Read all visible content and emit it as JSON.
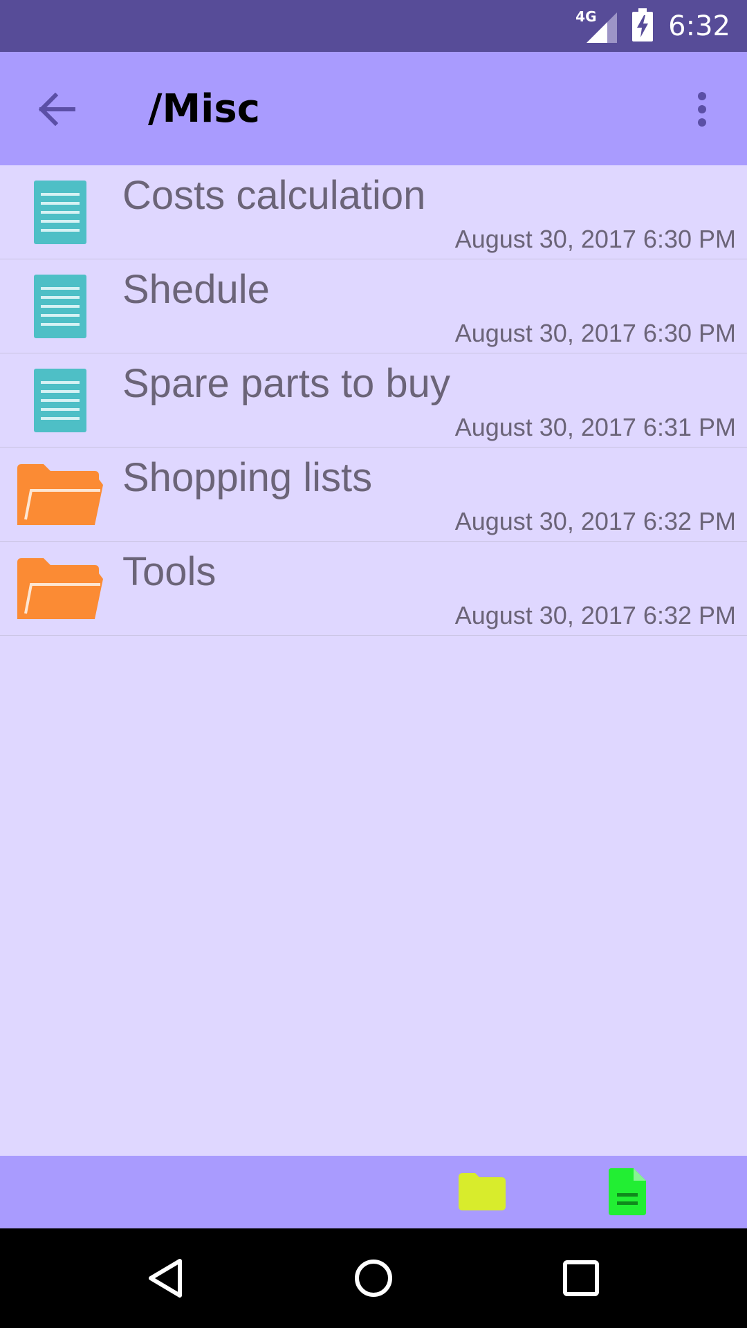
{
  "status_bar": {
    "network": "4G",
    "time": "6:32"
  },
  "app_bar": {
    "title": "/Misc",
    "back_icon": "arrow-left-icon",
    "menu_icon": "more-vertical-icon"
  },
  "items": [
    {
      "type": "note",
      "icon": "note-icon",
      "name": "Costs calculation",
      "date": "August 30, 2017 6:30 PM"
    },
    {
      "type": "note",
      "icon": "note-icon",
      "name": "Shedule",
      "date": "August 30, 2017 6:30 PM"
    },
    {
      "type": "note",
      "icon": "note-icon",
      "name": "Spare parts to buy",
      "date": "August 30, 2017 6:31 PM"
    },
    {
      "type": "folder",
      "icon": "folder-icon",
      "name": "Shopping lists",
      "date": "August 30, 2017 6:32 PM"
    },
    {
      "type": "folder",
      "icon": "folder-icon",
      "name": "Tools",
      "date": "August 30, 2017 6:32 PM"
    }
  ],
  "bottom_bar": {
    "new_folder_icon": "new-folder-icon",
    "new_note_icon": "new-note-icon"
  },
  "colors": {
    "status_bar": "#574c98",
    "app_bar": "#a99bfe",
    "background": "#dfd7ff",
    "note_icon": "#4ebfc6",
    "folder_icon": "#fb8b34",
    "new_folder": "#d8ec2c",
    "new_note": "#22ee33"
  }
}
